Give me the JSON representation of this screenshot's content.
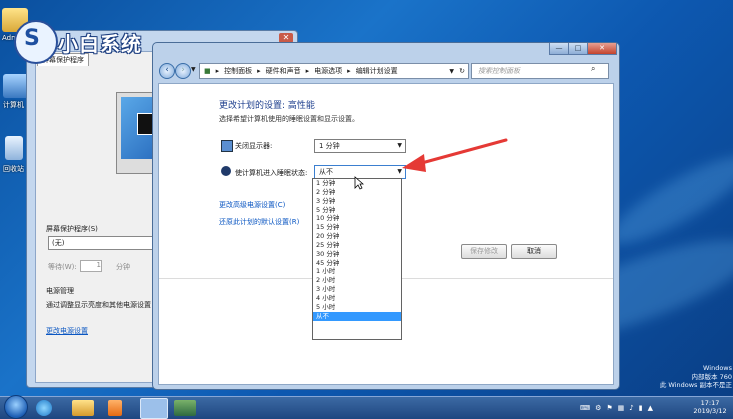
{
  "logo": {
    "text": "小白系统"
  },
  "desktop_icons": [
    {
      "label": "Adm"
    },
    {
      "label": "计算机"
    },
    {
      "label": "回收站"
    }
  ],
  "back_window": {
    "tab": "屏幕保护程序",
    "screensaver_label": "屏幕保护程序(S)",
    "screensaver_value": "(无)",
    "wait_label": "等待(W):",
    "wait_value": "1",
    "wait_unit": "分钟",
    "power_heading": "电源管理",
    "power_desc": "通过调整显示亮度和其他电源设置",
    "power_link": "更改电源设置"
  },
  "window": {
    "title_buttons": {
      "min": "—",
      "max": "□",
      "close": "✕"
    },
    "breadcrumb": [
      "控制面板",
      "硬件和声音",
      "电源选项",
      "编辑计划设置"
    ],
    "search_placeholder": "搜索控制面板",
    "heading": "更改计划的设置: 高性能",
    "description": "选择希望计算机使用的睡眠设置和显示设置。",
    "display_label": "关闭显示器:",
    "display_value": "1 分钟",
    "sleep_label": "使计算机进入睡眠状态:",
    "sleep_value": "从不",
    "link_advanced": "更改高级电源设置(C)",
    "link_restore": "还原此计划的默认设置(R)",
    "btn_save": "保存修改",
    "btn_cancel": "取消"
  },
  "dropdown_options": [
    "1 分钟",
    "2 分钟",
    "3 分钟",
    "5 分钟",
    "10 分钟",
    "15 分钟",
    "20 分钟",
    "25 分钟",
    "30 分钟",
    "45 分钟",
    "1 小时",
    "2 小时",
    "3 小时",
    "4 小时",
    "5 小时",
    "从不"
  ],
  "dropdown_selected": "从不",
  "watermark": [
    "Windows",
    "内部版本 760",
    "此 Windows 副本不是正",
    "17:17",
    "2019/3/12"
  ],
  "colors": {
    "accent_arrow": "#e53935",
    "link": "#0a56c2",
    "selected": "#3399ff"
  }
}
